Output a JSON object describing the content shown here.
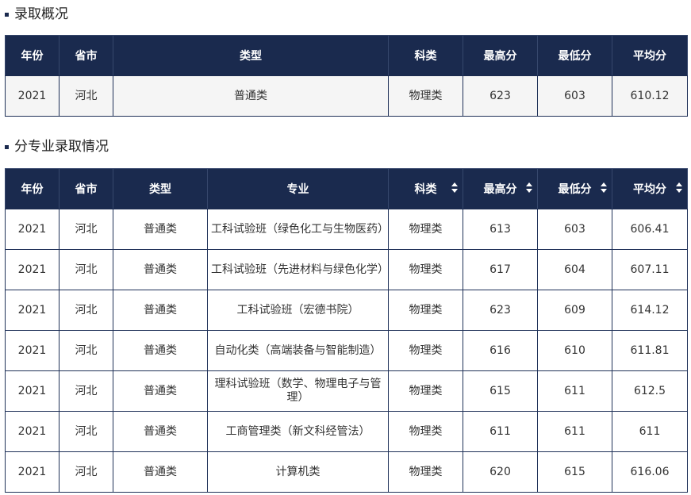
{
  "section1": {
    "title": "录取概况"
  },
  "table1": {
    "headers": [
      "年份",
      "省市",
      "类型",
      "科类",
      "最高分",
      "最低分",
      "平均分"
    ],
    "rows": [
      [
        "2021",
        "河北",
        "普通类",
        "物理类",
        "623",
        "603",
        "610.12"
      ]
    ]
  },
  "section2": {
    "title": "分专业录取情况"
  },
  "table2": {
    "headers": [
      "年份",
      "省市",
      "类型",
      "专业",
      "科类",
      "最高分",
      "最低分",
      "平均分"
    ],
    "rows": [
      [
        "2021",
        "河北",
        "普通类",
        "工科试验班（绿色化工与生物医药）",
        "物理类",
        "613",
        "603",
        "606.41"
      ],
      [
        "2021",
        "河北",
        "普通类",
        "工科试验班（先进材料与绿色化学）",
        "物理类",
        "617",
        "604",
        "607.11"
      ],
      [
        "2021",
        "河北",
        "普通类",
        "工科试验班（宏德书院）",
        "物理类",
        "623",
        "609",
        "614.12"
      ],
      [
        "2021",
        "河北",
        "普通类",
        "自动化类（高端装备与智能制造）",
        "物理类",
        "616",
        "610",
        "611.81"
      ],
      [
        "2021",
        "河北",
        "普通类",
        "理科试验班（数学、物理电子与管理）",
        "物理类",
        "615",
        "611",
        "612.5"
      ],
      [
        "2021",
        "河北",
        "普通类",
        "工商管理类（新文科经管法）",
        "物理类",
        "611",
        "611",
        "611"
      ],
      [
        "2021",
        "河北",
        "普通类",
        "计算机类",
        "物理类",
        "620",
        "615",
        "616.06"
      ]
    ]
  },
  "colors": {
    "header_bg": "#1a2a4e",
    "border": "#1f3158",
    "summary_row_bg": "#f5f5f5"
  },
  "icons": {
    "sort": "sort-icon"
  }
}
